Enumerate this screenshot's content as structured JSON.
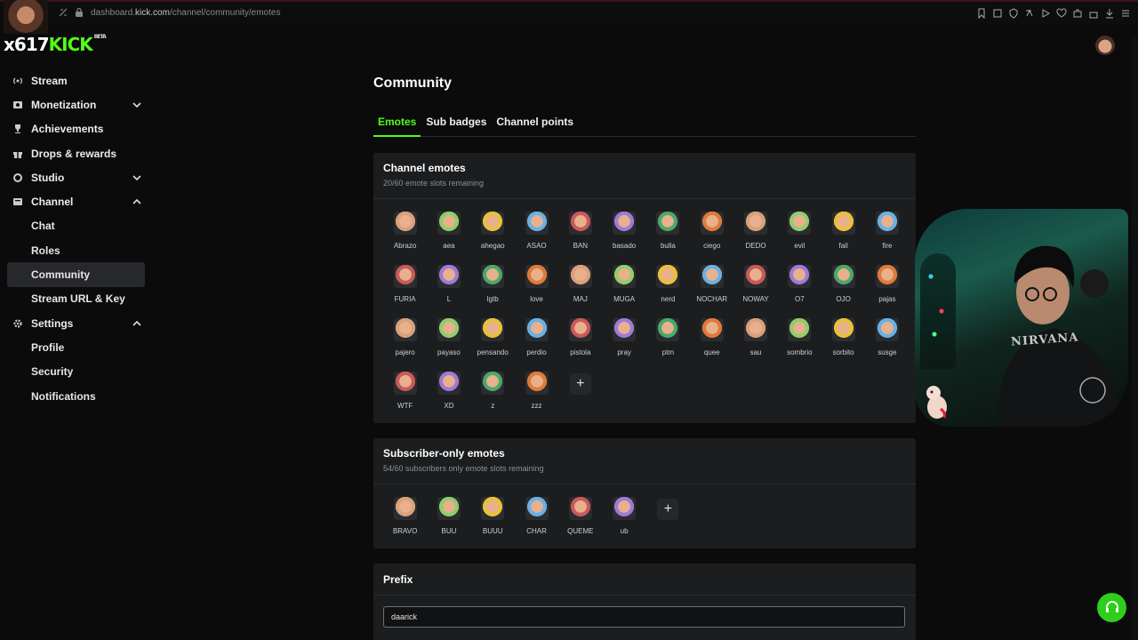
{
  "browser": {
    "url_host": "dashboard.",
    "url_domain": "kick.com",
    "url_path": "/channel/community/emotes"
  },
  "overlay": {
    "logo_prefix": "x617",
    "logo_brand": "KICK",
    "logo_badge": "BETA"
  },
  "sidebar": {
    "items": [
      {
        "label": "Stream",
        "icon": "broadcast-icon"
      },
      {
        "label": "Monetization",
        "icon": "dollar-icon",
        "chevron": "down"
      },
      {
        "label": "Achievements",
        "icon": "trophy-icon"
      },
      {
        "label": "Drops & rewards",
        "icon": "gift-icon"
      },
      {
        "label": "Studio",
        "icon": "studio-icon",
        "chevron": "down"
      },
      {
        "label": "Channel",
        "icon": "channel-icon",
        "chevron": "up"
      }
    ],
    "channel_sub": [
      "Chat",
      "Roles",
      "Community",
      "Stream URL & Key"
    ],
    "settings": {
      "label": "Settings",
      "icon": "gear-icon",
      "chevron": "up"
    },
    "settings_sub": [
      "Profile",
      "Security",
      "Notifications"
    ],
    "active": "Community"
  },
  "page": {
    "title": "Community",
    "tabs": [
      "Emotes",
      "Sub badges",
      "Channel points"
    ],
    "active_tab": "Emotes"
  },
  "channel_emotes": {
    "title": "Channel emotes",
    "subtitle": "20/60 emote slots remaining",
    "emotes": [
      "Abrazo",
      "aea",
      "ahegao",
      "ASAO",
      "BAN",
      "basado",
      "bulla",
      "ciego",
      "DEDO",
      "evil",
      "fail",
      "fire",
      "FURIA",
      "L",
      "lgtb",
      "love",
      "MAJ",
      "MUGA",
      "nerd",
      "NOCHAR",
      "NOWAY",
      "O7",
      "OJO",
      "pajas",
      "pajero",
      "payaso",
      "pensando",
      "perdio",
      "pistola",
      "pray",
      "ptm",
      "quee",
      "sau",
      "sombrio",
      "sorbito",
      "susge",
      "WTF",
      "XD",
      "z",
      "zzz"
    ],
    "add_label": "+"
  },
  "subscriber_emotes": {
    "title": "Subscriber-only emotes",
    "subtitle": "54/60 subscribers only emote slots remaining",
    "emotes": [
      "BRAVO",
      "BUU",
      "BUUU",
      "CHAR",
      "QUEME",
      "ub"
    ],
    "add_label": "+"
  },
  "prefix": {
    "title": "Prefix",
    "value": "daarick"
  },
  "webcam": {
    "shirt_text": "NIRVANA"
  },
  "colors": {
    "accent": "#53fc18",
    "card_bg": "#1b1d1f",
    "page_bg": "#0b0b0c",
    "help_button": "#2ecf1a"
  }
}
